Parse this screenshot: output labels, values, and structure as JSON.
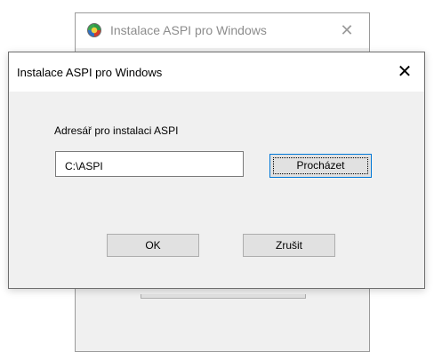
{
  "background_window": {
    "title": "Instalace ASPI pro Windows",
    "close_glyph": "✕",
    "icon": "aspi-app-icon"
  },
  "dialog": {
    "title": "Instalace ASPI pro Windows",
    "close_glyph": "✕",
    "label": "Adresář pro instalaci ASPI",
    "path_value": "C:\\ASPI",
    "browse_label": "Procházet",
    "ok_label": "OK",
    "cancel_label": "Zrušit"
  },
  "colors": {
    "dialog_bg": "#f0f0f0",
    "titlebar_bg": "#ffffff",
    "focus_border": "#0078d7",
    "button_bg": "#e1e1e1"
  }
}
